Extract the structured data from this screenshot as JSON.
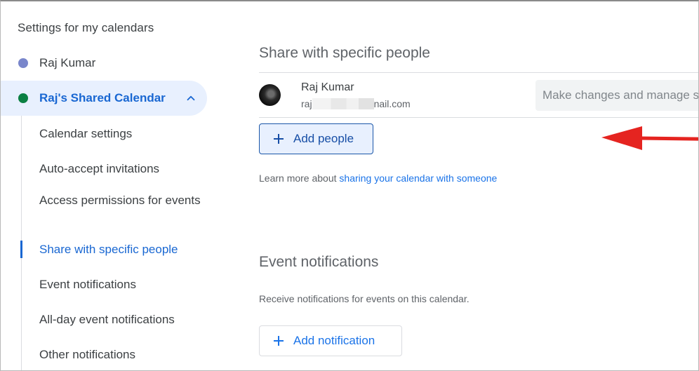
{
  "sidebar": {
    "heading": "Settings for my calendars",
    "calendars": [
      {
        "label": "Raj Kumar",
        "color": "#7986cb"
      },
      {
        "label": "Raj's Shared Calendar",
        "color": "#0b8043"
      }
    ],
    "subnav": [
      "Calendar settings",
      "Auto-accept invitations",
      "Access permissions for events",
      "Share with specific people",
      "Event notifications",
      "All-day event notifications",
      "Other notifications"
    ],
    "active_index": 3
  },
  "share": {
    "title": "Share with specific people",
    "person": {
      "name": "Raj Kumar",
      "email_prefix": "raj",
      "email_suffix": "nail.com",
      "permission_placeholder": "Make changes and manage s"
    },
    "add_people_label": "Add people",
    "help_prefix": "Learn more about ",
    "help_link": "sharing your calendar with someone"
  },
  "notifications": {
    "title": "Event notifications",
    "description": "Receive notifications for events on this calendar.",
    "add_label": "Add notification"
  },
  "colors": {
    "accent": "#1a73e8",
    "active_bg": "#e8f0fe",
    "arrow": "#e52420"
  }
}
